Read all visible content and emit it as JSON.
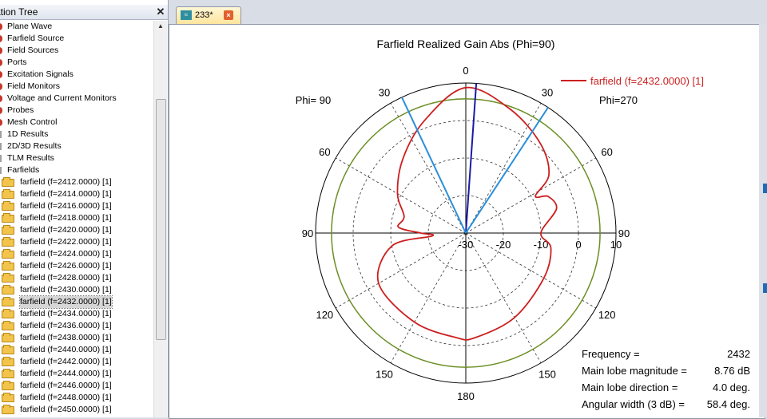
{
  "tree": {
    "title": "ation Tree",
    "close": "✕",
    "items": [
      {
        "label": "Plane Wave",
        "icon": "red-node-icon"
      },
      {
        "label": "Farfield Source",
        "icon": "red-node-icon"
      },
      {
        "label": "Field Sources",
        "icon": "red-node-icon"
      },
      {
        "label": "Ports",
        "icon": "red-node-icon"
      },
      {
        "label": "Excitation Signals",
        "icon": "red-node-icon"
      },
      {
        "label": "Field Monitors",
        "icon": "red-node-icon"
      },
      {
        "label": "Voltage and Current Monitors",
        "icon": "red-node-icon"
      },
      {
        "label": "Probes",
        "icon": "red-node-icon"
      },
      {
        "label": "Mesh Control",
        "icon": "red-node-icon"
      },
      {
        "label": "1D Results",
        "icon": "gray-node-icon"
      },
      {
        "label": "2D/3D Results",
        "icon": "gray-node-icon"
      },
      {
        "label": "TLM Results",
        "icon": "gray-node-icon"
      },
      {
        "label": "Farfields",
        "icon": "gray-node-icon"
      },
      {
        "label": "farfield (f=2412.0000) [1]",
        "icon": "folder-icon"
      },
      {
        "label": "farfield (f=2414.0000) [1]",
        "icon": "folder-icon"
      },
      {
        "label": "farfield (f=2416.0000) [1]",
        "icon": "folder-icon"
      },
      {
        "label": "farfield (f=2418.0000) [1]",
        "icon": "folder-icon"
      },
      {
        "label": "farfield (f=2420.0000) [1]",
        "icon": "folder-icon"
      },
      {
        "label": "farfield (f=2422.0000) [1]",
        "icon": "folder-icon"
      },
      {
        "label": "farfield (f=2424.0000) [1]",
        "icon": "folder-icon"
      },
      {
        "label": "farfield (f=2426.0000) [1]",
        "icon": "folder-icon"
      },
      {
        "label": "farfield (f=2428.0000) [1]",
        "icon": "folder-icon"
      },
      {
        "label": "farfield (f=2430.0000) [1]",
        "icon": "folder-icon"
      },
      {
        "label": "farfield (f=2432.0000) [1]",
        "icon": "folder-icon",
        "selected": true
      },
      {
        "label": "farfield (f=2434.0000) [1]",
        "icon": "folder-icon"
      },
      {
        "label": "farfield (f=2436.0000) [1]",
        "icon": "folder-icon"
      },
      {
        "label": "farfield (f=2438.0000) [1]",
        "icon": "folder-icon"
      },
      {
        "label": "farfield (f=2440.0000) [1]",
        "icon": "folder-icon"
      },
      {
        "label": "farfield (f=2442.0000) [1]",
        "icon": "folder-icon"
      },
      {
        "label": "farfield (f=2444.0000) [1]",
        "icon": "folder-icon"
      },
      {
        "label": "farfield (f=2446.0000) [1]",
        "icon": "folder-icon"
      },
      {
        "label": "farfield (f=2448.0000) [1]",
        "icon": "folder-icon"
      },
      {
        "label": "farfield (f=2450.0000) [1]",
        "icon": "folder-icon"
      }
    ]
  },
  "tabs": [
    {
      "label": "233*",
      "icon": "farfield-plot-icon",
      "close": "×"
    }
  ],
  "chart_data": {
    "type": "polar",
    "title": "Farfield Realized Gain Abs (Phi=90)",
    "left_label": "Phi= 90",
    "right_label": "Phi=270",
    "legend": [
      {
        "label": "farfield (f=2432.0000) [1]",
        "color": "#cc1f1f"
      }
    ],
    "legend_position": "top-right",
    "angle_labels": [
      {
        "label": "0",
        "angle": 0
      },
      {
        "label": "30",
        "angle": 30
      },
      {
        "label": "30",
        "angle": -30
      },
      {
        "label": "60",
        "angle": 60
      },
      {
        "label": "60",
        "angle": -60
      },
      {
        "label": "90",
        "angle": 90
      },
      {
        "label": "90",
        "angle": -90
      },
      {
        "label": "120",
        "angle": 120
      },
      {
        "label": "120",
        "angle": -120
      },
      {
        "label": "150",
        "angle": 150
      },
      {
        "label": "150",
        "angle": -150
      },
      {
        "label": "180",
        "angle": 180
      }
    ],
    "radial_ticks": [
      "-30",
      "-20",
      "-10",
      "0",
      "10"
    ],
    "r_range": [
      -30,
      10
    ],
    "series": [
      {
        "name": "farfield (f=2432.0000) [1]",
        "color": "#cc1f1f",
        "points": [
          [
            -175,
            -2
          ],
          [
            -150,
            -2.6
          ],
          [
            -120,
            -3.2
          ],
          [
            -100,
            -10
          ],
          [
            -95,
            -21
          ],
          [
            -90,
            -18
          ],
          [
            -85,
            -12
          ],
          [
            -75,
            -13
          ],
          [
            -60,
            -9
          ],
          [
            -40,
            -4
          ],
          [
            -20,
            2
          ],
          [
            0,
            8.76
          ],
          [
            20,
            5
          ],
          [
            40,
            1
          ],
          [
            55,
            -3
          ],
          [
            62,
            -9
          ],
          [
            66,
            -6
          ],
          [
            75,
            -5
          ],
          [
            90,
            -10
          ],
          [
            100,
            -7
          ],
          [
            120,
            -6
          ],
          [
            150,
            -4
          ],
          [
            175,
            -2
          ]
        ]
      },
      {
        "name": "3 dB level",
        "color": "#6b8e23",
        "points": []
      }
    ],
    "markers": [
      {
        "name": "main-lobe-direction",
        "color": "#1a1aa6",
        "angle": 4.0
      },
      {
        "name": "beamwidth-edge",
        "color": "#2b8fd9",
        "angle": -25.2
      },
      {
        "name": "beamwidth-edge",
        "color": "#2b8fd9",
        "angle": 33.2
      }
    ],
    "reference_circle_db": 5.76,
    "info": [
      {
        "label": "Frequency =",
        "value": "2432"
      },
      {
        "label": "Main lobe magnitude =",
        "value": "8.76 dB"
      },
      {
        "label": "Main lobe direction =",
        "value": "4.0 deg."
      },
      {
        "label": "Angular width (3 dB) =",
        "value": "58.4 deg."
      }
    ]
  }
}
